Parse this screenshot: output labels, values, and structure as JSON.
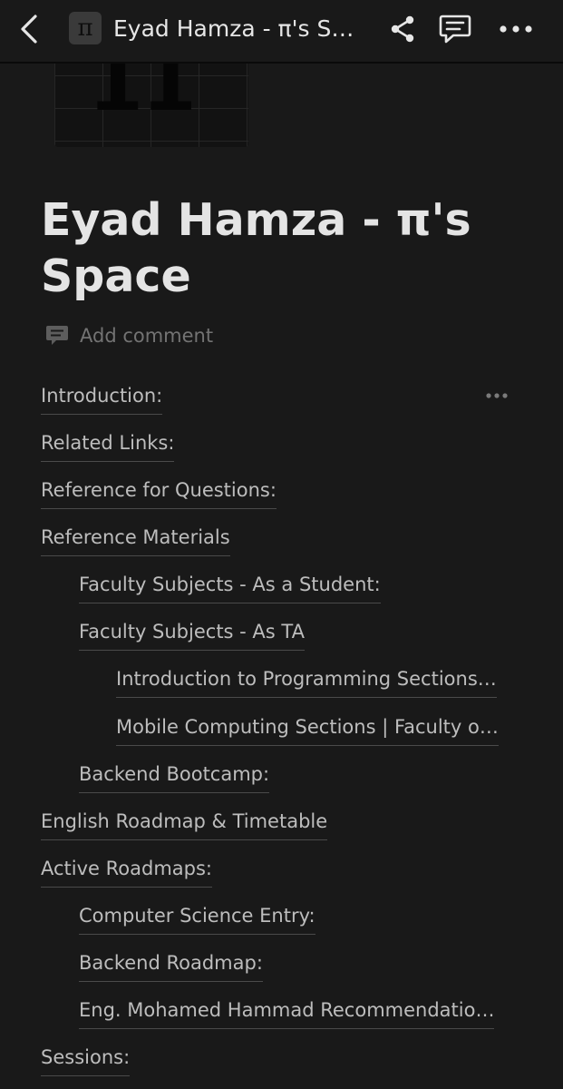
{
  "header": {
    "title": "Eyad Hamza - π's S…",
    "page_icon_glyph": "π",
    "icons": [
      "back-chevron-icon",
      "share-icon",
      "comment-icon",
      "more-icon"
    ]
  },
  "cover": {
    "glyph": "π"
  },
  "page": {
    "title": "Eyad Hamza - π's Space",
    "add_comment_label": "Add comment"
  },
  "toc": [
    {
      "label": "Introduction:",
      "level": 0
    },
    {
      "label": "Related Links:",
      "level": 0
    },
    {
      "label": "Reference for Questions:",
      "level": 0
    },
    {
      "label": "Reference Materials",
      "level": 0
    },
    {
      "label": "Faculty Subjects - As a Student:",
      "level": 1
    },
    {
      "label": "Faculty Subjects - As TA",
      "level": 1
    },
    {
      "label": "Introduction to Programming Sections…",
      "level": 2
    },
    {
      "label": "Mobile Computing Sections | Faculty o…",
      "level": 2
    },
    {
      "label": "Backend Bootcamp:",
      "level": 1
    },
    {
      "label": "English Roadmap & Timetable",
      "level": 0
    },
    {
      "label": "Active Roadmaps:",
      "level": 0
    },
    {
      "label": "Computer Science Entry:",
      "level": 1
    },
    {
      "label": "Backend Roadmap:",
      "level": 1
    },
    {
      "label": "Eng. Mohamed Hammad Recommendatio…",
      "level": 1
    },
    {
      "label": "Sessions:",
      "level": 0
    }
  ],
  "colors": {
    "background": "#191919",
    "text_primary": "#e4e4e4",
    "text_link": "#bdbdbd",
    "text_muted": "#737373",
    "underline": "#4a4a4a"
  }
}
